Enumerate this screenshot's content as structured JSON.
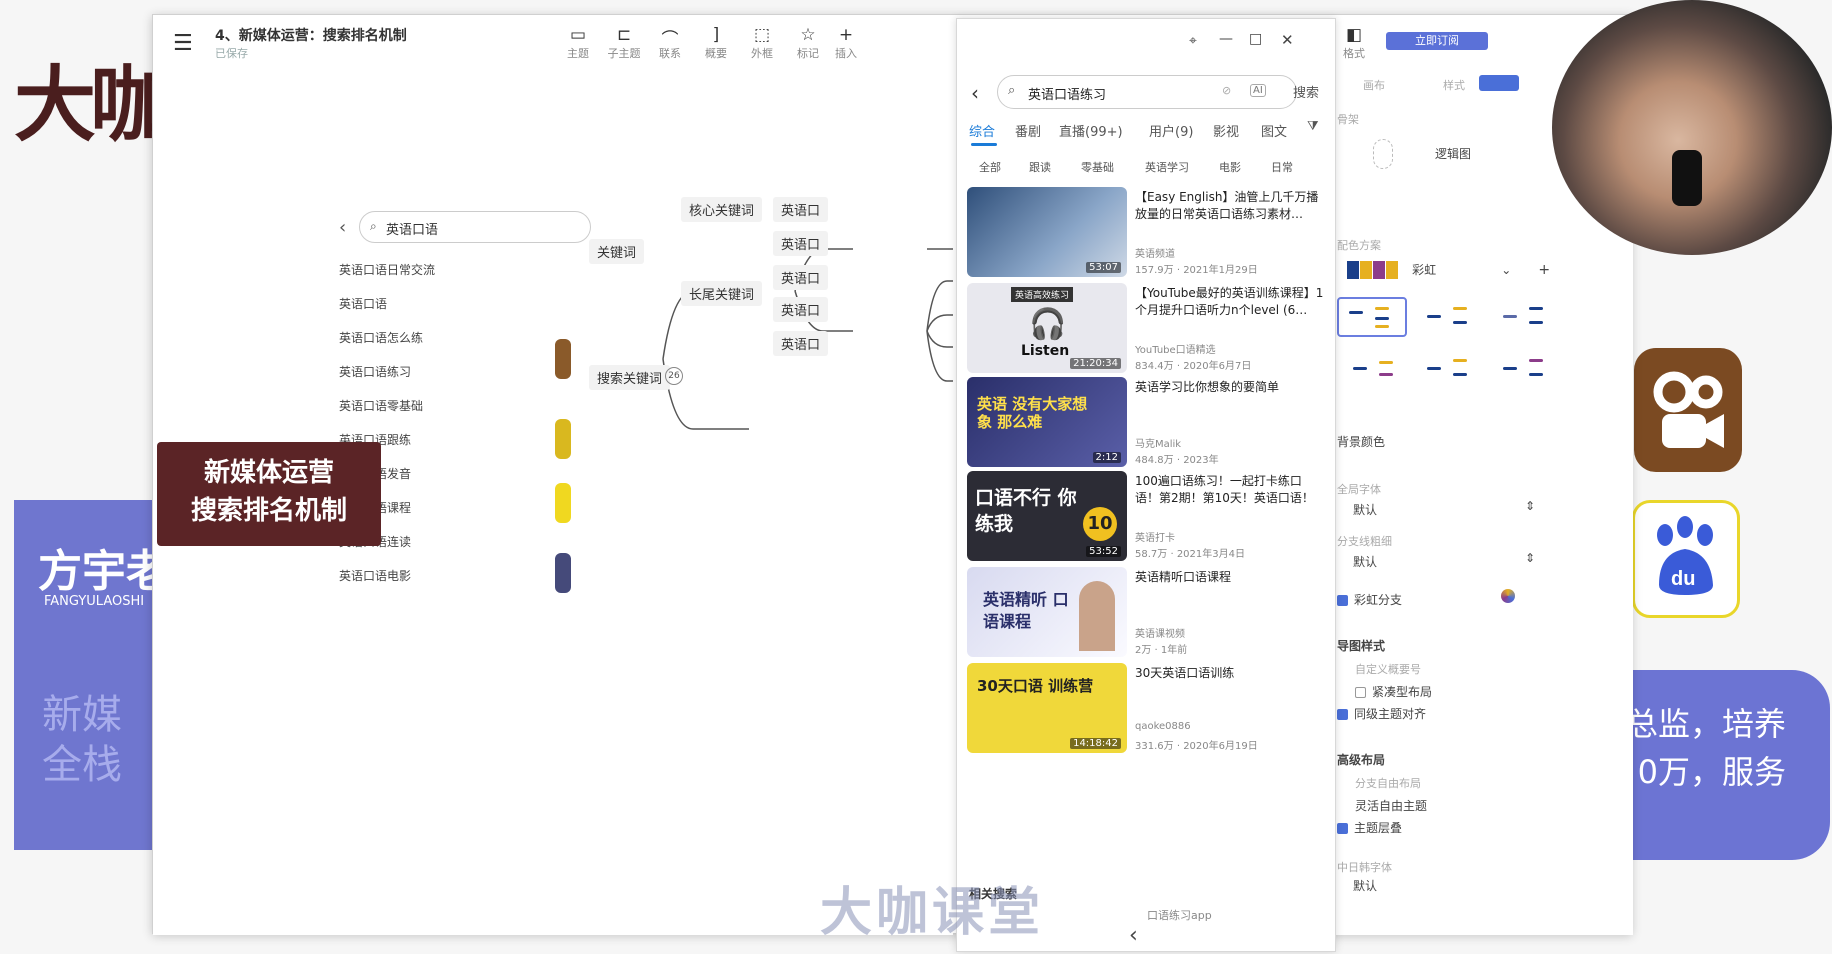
{
  "background": {
    "slide_logo": "大咖",
    "teacher_name": "方宇老",
    "teacher_sub": "FANGYULAOSHI",
    "teacher_ghost": "新媒全栈",
    "banner_text_1": "总监，培养",
    "banner_text_2": "0万，服务",
    "watermark": "大咖课堂",
    "colors": {
      "slide_blue": "#6f76cf",
      "logo_brown": "#4a1e1e",
      "central_node": "#5b2426"
    }
  },
  "window": {
    "title": "4、新媒体运营：搜索排名机制",
    "subtitle": "已保存",
    "toolbar": [
      {
        "label": "主题",
        "icon": "topic-icon"
      },
      {
        "label": "子主题",
        "icon": "subtopic-icon"
      },
      {
        "label": "联系",
        "icon": "relation-icon"
      },
      {
        "label": "概要",
        "icon": "summary-icon"
      },
      {
        "label": "外框",
        "icon": "boundary-icon"
      },
      {
        "label": "标记",
        "icon": "star-icon"
      },
      {
        "label": "插入",
        "icon": "plus-icon"
      }
    ],
    "format_label": "格式"
  },
  "search_overlay": {
    "query": "英语口语",
    "items": [
      "英语口语日常交流",
      "英语口语",
      "英语口语怎么练",
      "英语口语练习",
      "英语口语零基础",
      "英语口语跟练",
      "英语口语发音",
      "英语口语课程",
      "英语口语连读",
      "英语口语电影"
    ]
  },
  "mindmap": {
    "central": {
      "line1": "新媒体运营",
      "line2": "搜索排名机制"
    },
    "keyword": "关键词",
    "core_keyword": "核心关键词",
    "long_tail": "长尾关键词",
    "search_keyword": "搜索关键词",
    "leaf_text": "英语口",
    "search_badge": "26",
    "leaves_count": 5
  },
  "video_panel": {
    "query": "英语口语练习",
    "search_button": "搜索",
    "tabs": [
      "综合",
      "番剧",
      "直播(99+)",
      "用户(9)",
      "影视",
      "图文"
    ],
    "chips": [
      "全部",
      "跟读",
      "零基础",
      "英语学习",
      "电影",
      "日常"
    ],
    "results": [
      {
        "title": "【Easy English】油管上几千万播放量的日常英语口语练习素材…",
        "author": "英语频道",
        "views": "157.9万",
        "date": "2021年1月29日",
        "duration": "53:07",
        "thumb_text": "",
        "thumb_color": "#3b5d8a"
      },
      {
        "title": "【YouTube最好的英语训练课程】1个月提升口语听力n个level (6…",
        "author": "YouTube口语精选",
        "views": "834.4万",
        "date": "2020年6月7日",
        "duration": "21:20:34",
        "thumb_text": "Listen",
        "thumb_color": "#e9e9ee"
      },
      {
        "title": "英语学习比你想象的要简单",
        "author": "马克Malik",
        "views": "484.8万",
        "date": "2023年",
        "duration": "2:12",
        "thumb_text": "英语 没有大家想象 那么难",
        "thumb_color": "#3a3f7a"
      },
      {
        "title": "100遍口语练习！一起打卡练口语！第2期！第10天！英语口语！",
        "author": "英语打卡",
        "views": "58.7万",
        "date": "2021年3月4日",
        "duration": "53:52",
        "thumb_text": "口语不行 你练我",
        "thumb_color": "#2c2c35"
      },
      {
        "title": "英语精听口语课程",
        "author": "英语课视频",
        "views": "2万",
        "date": "1年前",
        "duration": "",
        "thumb_text": "英语精听 口语课程",
        "thumb_color": "#5a5fa8"
      },
      {
        "title": "30天英语口语训练",
        "author": "qaoke0886",
        "views": "331.6万",
        "date": "2020年6月19日",
        "duration": "14:18:42",
        "thumb_text": "30天口语 训练营",
        "thumb_color": "#f0d83a"
      }
    ],
    "related_label": "相关搜索",
    "related_item": "口语练习app"
  },
  "right_sidebar": {
    "subscribe": "立即订阅",
    "tabs": [
      "画布",
      "样式"
    ],
    "structure_label": "骨架",
    "structure_value": "逻辑图",
    "color_scheme_label": "配色方案",
    "color_scheme_value": "彩虹",
    "swatch_colors": [
      "#1a3f8a",
      "#e6b020",
      "#1a3f8a",
      "#e6b020"
    ],
    "background_color_label": "背景颜色",
    "font_label": "全局字体",
    "font_value": "默认",
    "branch_width_label": "分支线粗细",
    "branch_width_value": "默认",
    "rainbow_branch_label": "彩虹分支",
    "map_style_label": "导图样式",
    "map_style_faint": "自定义概要号",
    "compact_layout": "紧凑型布局",
    "align_same_level": "同级主题对齐",
    "advanced_layout_label": "高级布局",
    "advanced_faint": "分支自由布局",
    "flexible_topic": "灵活自由主题",
    "topic_overlap": "主题层叠",
    "cjk_font_label": "中日韩字体",
    "cjk_font_value": "默认"
  }
}
